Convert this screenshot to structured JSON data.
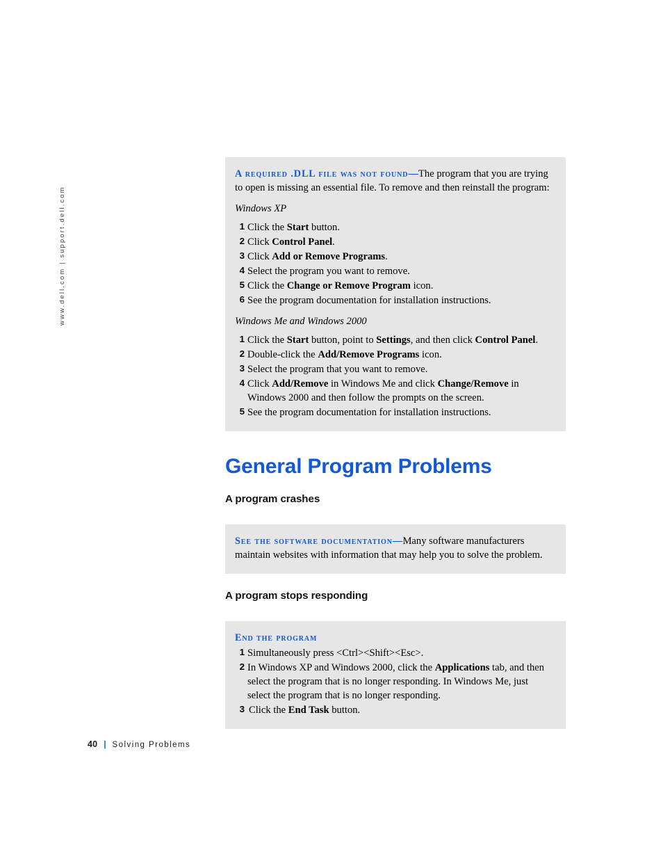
{
  "page": {
    "side_url": "www.dell.com | support.dell.com",
    "footer_page_number": "40",
    "footer_separator": "|",
    "footer_title": "Solving Problems",
    "accent_blue": "#1358d8",
    "callout_bg": "#e6e6e6"
  },
  "callout_dll": {
    "lead": "A required .DLL file was not found",
    "dash": "—",
    "body": "The program that you are trying to open is missing an essential file. To remove and then reinstall the program:",
    "os_xp_label": "Windows XP",
    "xp_steps": [
      {
        "num": "1",
        "pre": "Click the ",
        "bold": "Start",
        "post": " button."
      },
      {
        "num": "2",
        "pre": "Click ",
        "bold": "Control Panel",
        "post": "."
      },
      {
        "num": "3",
        "pre": "Click ",
        "bold": "Add or Remove Programs",
        "post": "."
      },
      {
        "num": "4",
        "pre": "Select the program you want to remove.",
        "bold": "",
        "post": ""
      },
      {
        "num": "5",
        "pre": "Click the ",
        "bold": "Change or Remove Program",
        "post": " icon."
      },
      {
        "num": "6",
        "pre": "See the program documentation for installation instructions.",
        "bold": "",
        "post": ""
      }
    ],
    "os_me2000_label": "Windows Me and Windows 2000",
    "me2000_steps": [
      {
        "num": "1",
        "pre": "Click the ",
        "bold": "Start",
        "mid": " button, point to ",
        "bold2": "Settings",
        "mid2": ", and then click ",
        "bold3": "Control Panel",
        "post": "."
      },
      {
        "num": "2",
        "pre": "Double-click the ",
        "bold": "Add/Remove Programs",
        "post": " icon."
      },
      {
        "num": "3",
        "pre": "Select the program that you want to remove.",
        "bold": "",
        "post": ""
      },
      {
        "num": "4",
        "pre": "Click ",
        "bold": "Add/Remove",
        "mid": " in Windows Me and click ",
        "bold2": "Change/Remove",
        "post": " in Windows 2000 and then follow the prompts on the screen."
      },
      {
        "num": "5",
        "pre": "See the program documentation for installation instructions.",
        "bold": "",
        "post": ""
      }
    ]
  },
  "section": {
    "title": "General Program Problems",
    "sub1": "A program crashes",
    "sub2": "A program stops responding"
  },
  "callout_software_doc": {
    "lead": "See the software documentation",
    "dash": "—",
    "body": "Many software manufacturers maintain websites with information that may help you to solve the problem."
  },
  "callout_end_program": {
    "lead": "End the program",
    "steps": [
      {
        "num": "1",
        "pre": "Simultaneously press <Ctrl><Shift><Esc>.",
        "bold": "",
        "post": ""
      },
      {
        "num": "2",
        "pre": "In Windows XP and Windows 2000, click the ",
        "bold": "Applications",
        "post": " tab, and then select the program that is no longer responding. In Windows Me, just select the program that is no longer responding."
      },
      {
        "num": "3",
        "pre": "Click the ",
        "bold": "End Task",
        "post": " button."
      }
    ]
  }
}
